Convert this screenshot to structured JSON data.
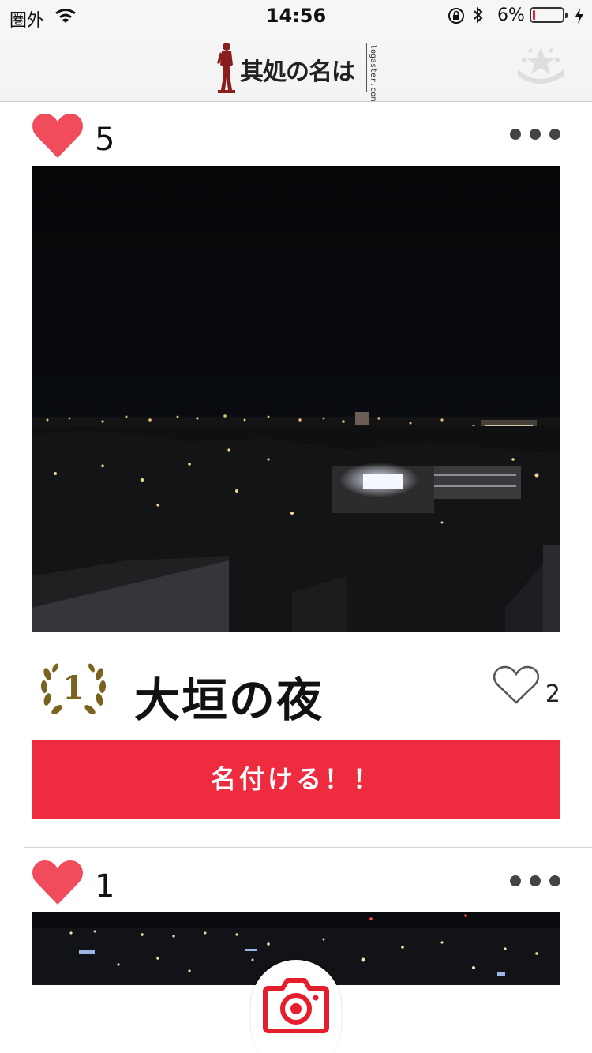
{
  "status_bar": {
    "carrier": "圏外",
    "time": "14:56",
    "battery_percent": "6%",
    "battery_level": 0.06
  },
  "header": {
    "app_title": "其処の名は",
    "logo_domain": "logaster.com",
    "left_icon": "statue-icon",
    "right_icon": "star-rank-icon"
  },
  "posts": [
    {
      "likes": "5",
      "name_rank": "1",
      "name": "大垣の夜",
      "name_likes": "2",
      "button_label": "名付ける！！"
    },
    {
      "likes": "1"
    }
  ],
  "colors": {
    "accent_red": "#ef2b3f",
    "heart_red": "#f14c5c",
    "laurel_gold": "#7a6220"
  },
  "fab": {
    "icon": "camera-icon"
  }
}
